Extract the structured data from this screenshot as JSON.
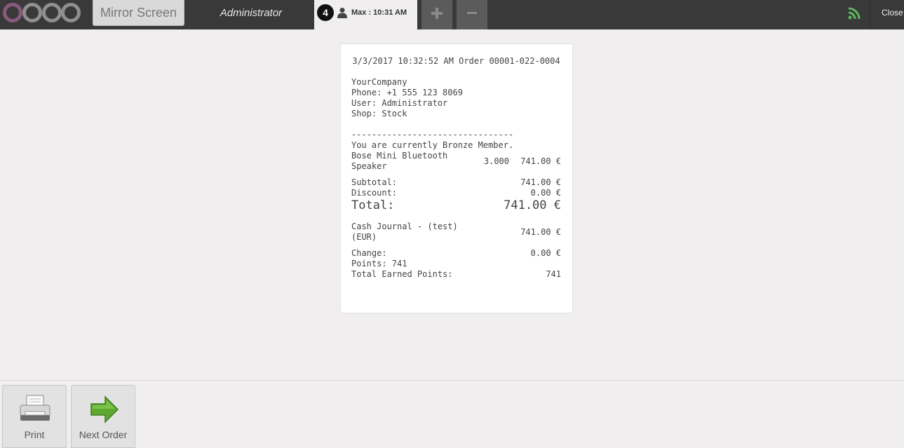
{
  "header": {
    "mirror_label": "Mirror Screen",
    "username": "Administrator",
    "order_tab": {
      "sequence": "4",
      "label": "Max : 10:31 AM"
    },
    "close_label": "Close",
    "colors": {
      "topbar": "#393939",
      "logo_o": "#875a7b",
      "wifi": "#5cb85c"
    }
  },
  "receipt": {
    "header_line": "3/3/2017 10:32:52 AM Order 00001-022-0004",
    "company": "YourCompany",
    "phone": "Phone: +1 555 123 8069",
    "user": "User: Administrator",
    "shop": "Shop: Stock",
    "separator": "--------------------------------",
    "membership": "You are currently Bronze Member.",
    "lines": [
      {
        "product": "Bose Mini Bluetooth Speaker",
        "qty": "3.000",
        "price": "741.00 €"
      }
    ],
    "subtotal_label": "Subtotal:",
    "subtotal": "741.00 €",
    "discount_label": "Discount:",
    "discount": "0.00 €",
    "total_label": "Total:",
    "total": "741.00 €",
    "payment_name": "Cash Journal - (test) (EUR)",
    "payment_amount": "741.00 €",
    "change_label": "Change:",
    "change": "0.00 €",
    "points": "Points: 741",
    "earned_label": "Total Earned Points:",
    "earned": "741"
  },
  "footer": {
    "print_label": "Print",
    "next_label": "Next Order"
  }
}
